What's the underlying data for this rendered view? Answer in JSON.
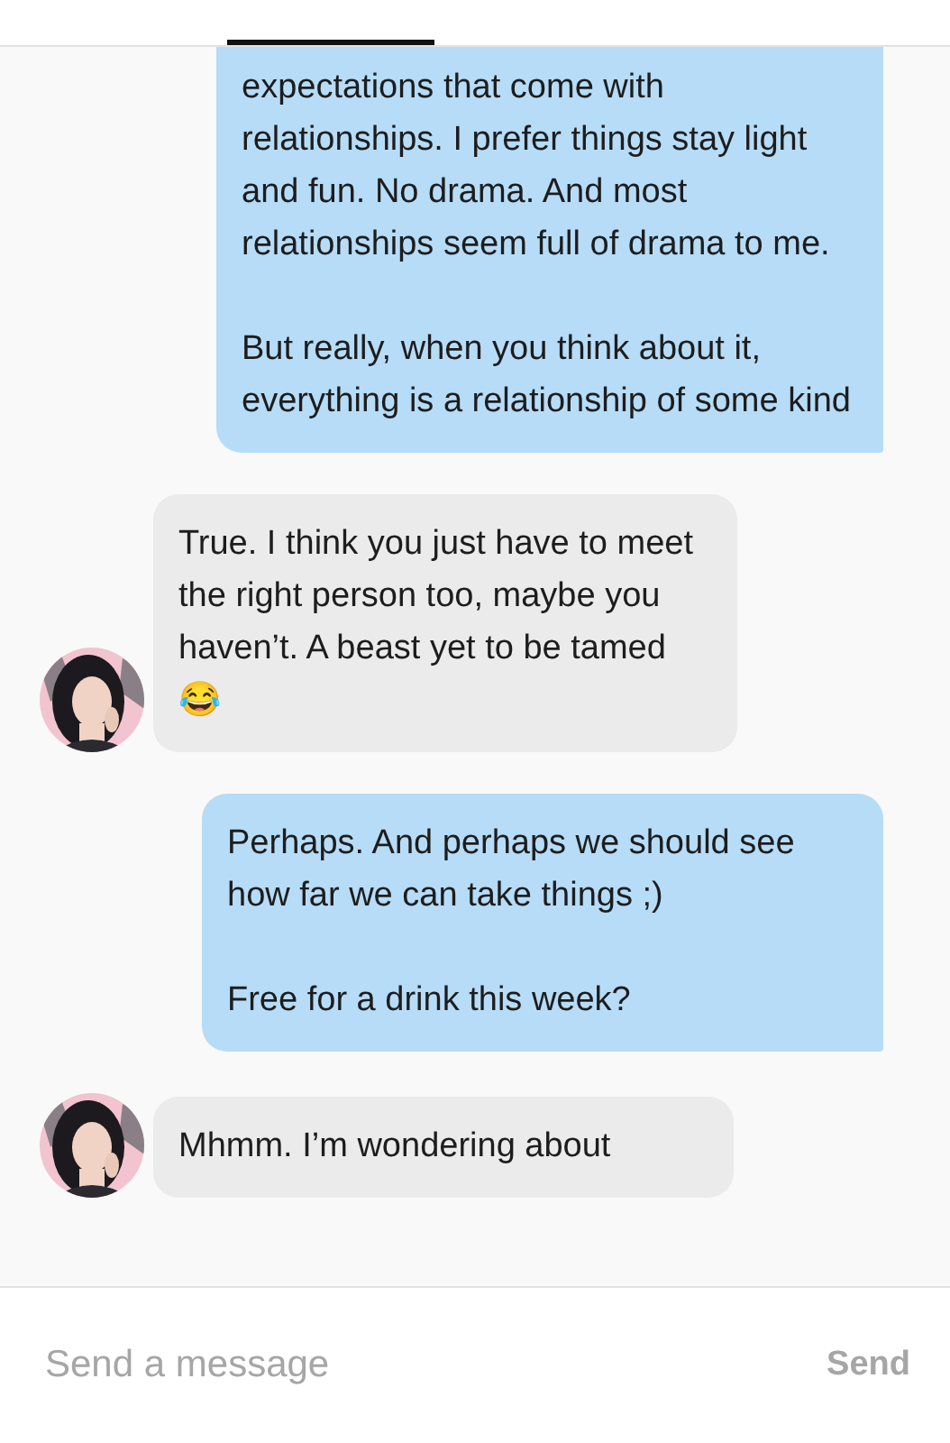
{
  "messages": [
    {
      "kind": "sent",
      "paragraphs": [
        "expectations that come with relationships. I prefer things stay light and fun. No drama. And most relationships seem full of drama to me.",
        "But really, when you think about it, everything is a relationship of some kind"
      ]
    },
    {
      "kind": "received",
      "paragraphs": [
        "True. I think you just have to meet the right person too, maybe you haven’t. A beast yet to be tamed 😂"
      ]
    },
    {
      "kind": "sent",
      "paragraphs": [
        "Perhaps. And perhaps we should see how far we can take things ;)",
        "Free for a drink this week?"
      ]
    },
    {
      "kind": "received",
      "paragraphs": [
        "Mhmm. I’m wondering about"
      ]
    }
  ],
  "composer": {
    "placeholder": "Send a message",
    "send": "Send"
  }
}
